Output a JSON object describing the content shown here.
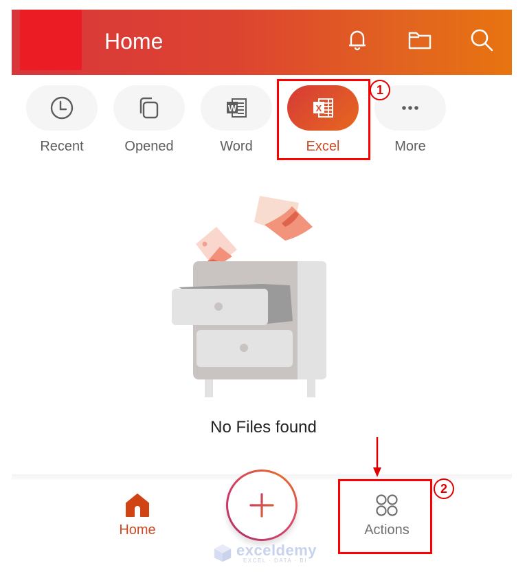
{
  "header": {
    "title": "Home",
    "icons": [
      "bell-icon",
      "folder-icon",
      "search-icon"
    ],
    "gradient_colors": [
      "#d8363b",
      "#e8740f"
    ],
    "redaction_color": "#ec1c24"
  },
  "tabs": [
    {
      "label": "Recent",
      "icon": "clock-icon",
      "active": false
    },
    {
      "label": "Opened",
      "icon": "copy-icon",
      "active": false
    },
    {
      "label": "Word",
      "icon": "word-icon",
      "active": false
    },
    {
      "label": "Excel",
      "icon": "excel-icon",
      "active": true
    },
    {
      "label": "More",
      "icon": "more-icon",
      "active": false
    }
  ],
  "annotations": [
    {
      "number": "1",
      "target": "Excel"
    },
    {
      "number": "2",
      "target": "Actions"
    }
  ],
  "empty_state": {
    "illustration": "empty-drawer-illustration",
    "message": "No Files found"
  },
  "bottom_nav": {
    "home_label": "Home",
    "create_button": "plus-icon",
    "actions_label": "Actions"
  },
  "watermark": {
    "name": "exceldemy",
    "tagline": "EXCEL · DATA · BI"
  },
  "colors": {
    "accent": "#c94a23",
    "annotation_red": "#ff0000"
  }
}
